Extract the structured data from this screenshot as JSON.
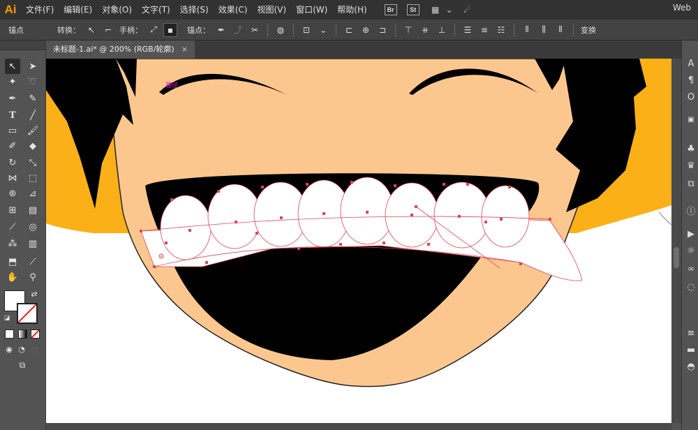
{
  "app": {
    "logo": "Ai",
    "workspace": "Web"
  },
  "menu": [
    "文件(F)",
    "编辑(E)",
    "对象(O)",
    "文字(T)",
    "选择(S)",
    "效果(C)",
    "视图(V)",
    "窗口(W)",
    "帮助(H)"
  ],
  "bridge_buttons": [
    "Br",
    "St"
  ],
  "controlbar": {
    "anchor_label": "锚点",
    "convert_label": "转换：",
    "handle_label": "手柄：",
    "anchor_point_label": "锚点：",
    "transform_label": "变换"
  },
  "document": {
    "tab_title": "未标题-1.ai* @ 200% (RGB/轮廓)",
    "close": "×"
  },
  "canvas": {
    "smart_guide_label": "路径"
  },
  "colors": {
    "skin": "#fcc78e",
    "hair": "#000000",
    "background_orange": "#fbb017",
    "shirt": "#ffffff",
    "path_highlight": "#e0435a"
  },
  "icons": {
    "selection": "selection-icon",
    "direct_selection": "direct-selection-icon",
    "magic_wand": "magic-wand-icon",
    "lasso": "lasso-icon",
    "pen": "pen-icon",
    "curvature": "curvature-icon",
    "type": "type-icon",
    "line": "line-icon",
    "rectangle": "rectangle-icon",
    "brush": "brush-icon",
    "shaper": "shaper-icon",
    "eraser": "eraser-icon",
    "rotate": "rotate-icon",
    "scale": "scale-icon",
    "width": "width-icon",
    "free_transform": "free-transform-icon",
    "shape_builder": "shape-builder-icon",
    "perspective": "perspective-icon",
    "mesh": "mesh-icon",
    "gradient": "gradient-icon",
    "eyedropper": "eyedropper-icon",
    "blend": "blend-icon",
    "symbol_sprayer": "symbol-sprayer-icon",
    "column_graph": "column-graph-icon",
    "artboard": "artboard-icon",
    "slice": "slice-icon",
    "hand": "hand-icon",
    "zoom": "zoom-icon"
  }
}
